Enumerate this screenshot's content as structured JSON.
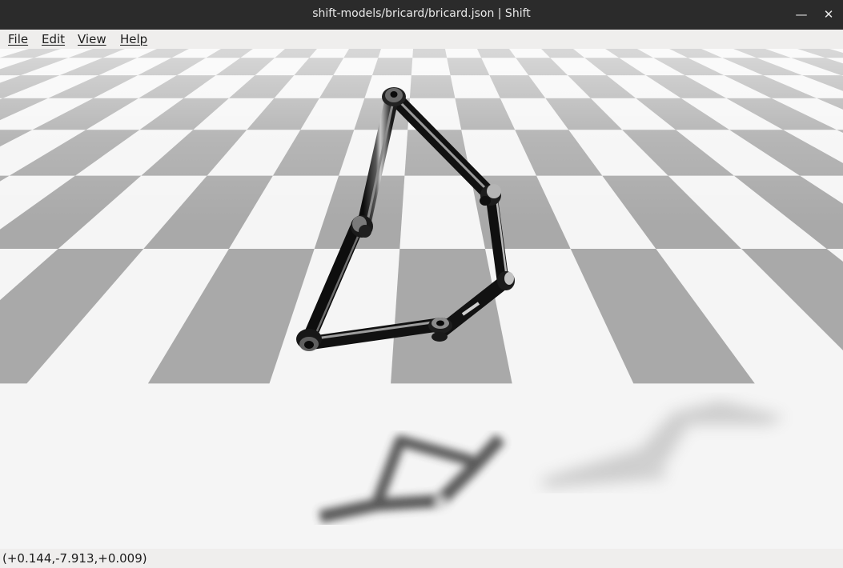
{
  "window": {
    "title": "shift-models/bricard/bricard.json | Shift",
    "minimize_glyph": "—",
    "close_glyph": "✕"
  },
  "menu": {
    "items": [
      {
        "label": "File"
      },
      {
        "label": "Edit"
      },
      {
        "label": "View"
      },
      {
        "label": "Help"
      }
    ]
  },
  "viewport": {
    "floor_colors": {
      "light": "#f5f5f5",
      "dark": "#a9a9a9"
    },
    "link_color": "#1a1a1a",
    "shadow_color": "#3c3c3c"
  },
  "status": {
    "coordinates": "(+0.144,-7.913,+0.009)"
  }
}
